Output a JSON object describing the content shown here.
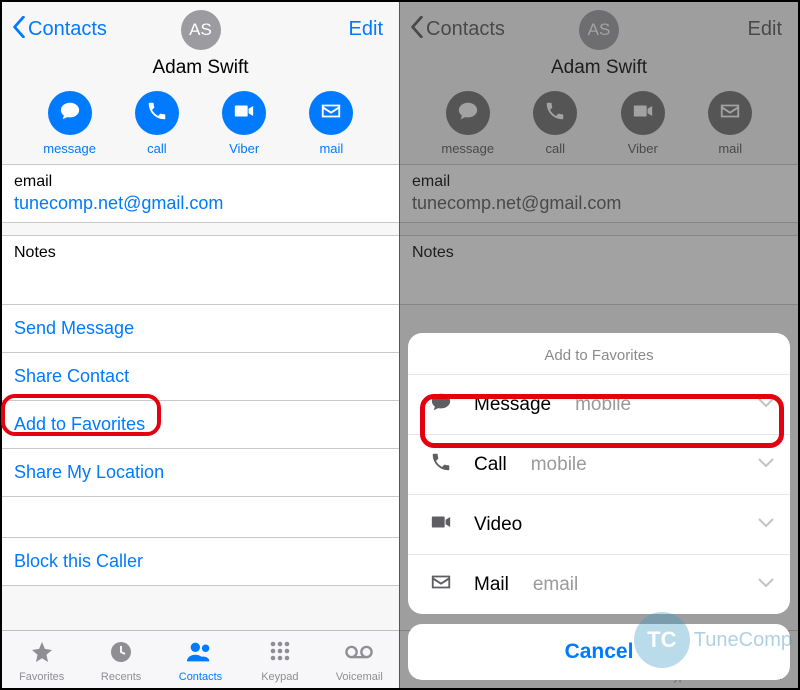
{
  "nav": {
    "back_label": "Contacts",
    "edit_label": "Edit"
  },
  "contact": {
    "initials": "AS",
    "name": "Adam Swift"
  },
  "actions": {
    "message": "message",
    "call": "call",
    "viber": "Viber",
    "mail": "mail"
  },
  "email": {
    "label": "email",
    "value": "tunecomp.net@gmail.com"
  },
  "notes_label": "Notes",
  "links": {
    "send_message": "Send Message",
    "share_contact": "Share Contact",
    "add_favorites": "Add to Favorites",
    "share_location": "Share My Location",
    "block_caller": "Block this Caller"
  },
  "tabs": {
    "favorites": "Favorites",
    "recents": "Recents",
    "contacts": "Contacts",
    "keypad": "Keypad",
    "voicemail": "Voicemail"
  },
  "sheet": {
    "title": "Add to Favorites",
    "rows": [
      {
        "label": "Message",
        "sub": "mobile"
      },
      {
        "label": "Call",
        "sub": "mobile"
      },
      {
        "label": "Video",
        "sub": ""
      },
      {
        "label": "Mail",
        "sub": "email"
      }
    ],
    "cancel": "Cancel"
  },
  "watermark": {
    "logo": "TC",
    "text": "TuneComp"
  }
}
